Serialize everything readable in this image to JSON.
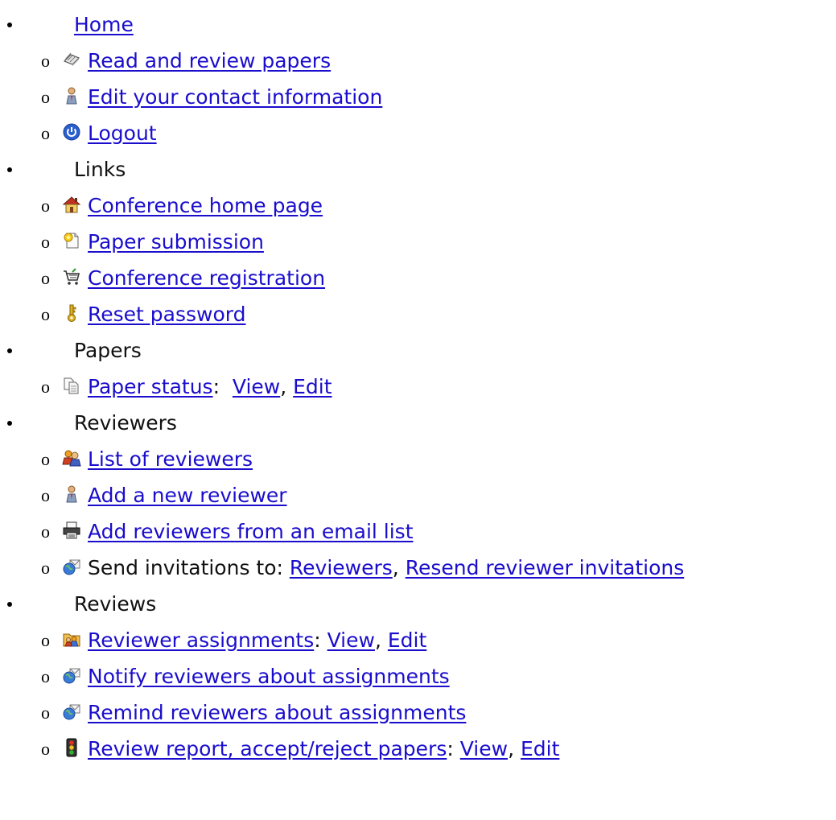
{
  "menu": {
    "home": {
      "label": "Home"
    },
    "home_items": [
      {
        "icon": "book-icon",
        "label": "Read and review papers"
      },
      {
        "icon": "person-icon",
        "label": "Edit your contact information"
      },
      {
        "icon": "power-icon",
        "label": "Logout"
      }
    ],
    "links": {
      "label": "Links"
    },
    "links_items": [
      {
        "icon": "house-icon",
        "label": "Conference home page"
      },
      {
        "icon": "new-document-icon",
        "label": "Paper submission"
      },
      {
        "icon": "shopping-cart-icon",
        "label": "Conference registration"
      },
      {
        "icon": "key-icon",
        "label": "Reset password"
      }
    ],
    "papers": {
      "label": "Papers"
    },
    "paper_status": {
      "icon": "documents-icon",
      "label": "Paper status",
      "sep": ":  ",
      "view": "View",
      "comma": ", ",
      "edit": "Edit"
    },
    "reviewers": {
      "label": "Reviewers"
    },
    "reviewers_items": [
      {
        "icon": "people-icon",
        "label": "List of reviewers"
      },
      {
        "icon": "person-icon",
        "label": "Add a new reviewer"
      },
      {
        "icon": "printer-icon",
        "label": "Add reviewers from an email list"
      }
    ],
    "send_invitations": {
      "icon": "globe-mail-icon",
      "text": "Send invitations to: ",
      "reviewers": "Reviewers",
      "comma": ", ",
      "resend": "Resend reviewer invitations"
    },
    "reviews": {
      "label": "Reviews"
    },
    "reviewer_assignments": {
      "icon": "folder-people-icon",
      "label": "Reviewer assignments",
      "sep": ": ",
      "view": "View",
      "comma": ", ",
      "edit": "Edit"
    },
    "reviews_items": [
      {
        "icon": "globe-mail-icon",
        "label": "Notify reviewers about assignments"
      },
      {
        "icon": "globe-mail-icon",
        "label": "Remind reviewers about assignments"
      }
    ],
    "review_report": {
      "icon": "traffic-light-icon",
      "label": "Review report, accept/reject papers",
      "sep": ": ",
      "view": "View",
      "comma": ", ",
      "edit": "Edit"
    },
    "sub_marker": "o"
  },
  "colors": {
    "link": "#1a0dcc",
    "text": "#111111",
    "background": "#ffffff"
  }
}
